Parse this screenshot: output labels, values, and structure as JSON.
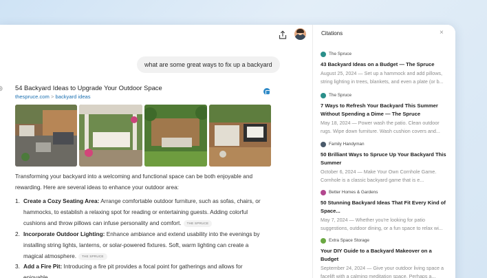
{
  "user_query": "what are some great ways to fix up a backyard",
  "result": {
    "title": "54 Backyard Ideas to Upgrade Your Outdoor Space",
    "url_domain": "thespruce.com",
    "url_separator": ">",
    "url_path": "backyard ideas"
  },
  "answer": {
    "intro": "Transforming your backyard into a welcoming and functional space can be both enjoyable and rewarding. Here are several ideas to enhance your outdoor area:",
    "items": [
      {
        "num": "1.",
        "heading": "Create a Cozy Seating Area:",
        "text": " Arrange comfortable outdoor furniture, such as sofas, chairs, or hammocks, to establish a relaxing spot for reading or entertaining guests. Adding colorful cushions and throw pillows can infuse personality and comfort.",
        "tag": "THE SPRUCE"
      },
      {
        "num": "2.",
        "heading": "Incorporate Outdoor Lighting:",
        "text": " Enhance ambiance and extend usability into the evenings by installing string lights, lanterns, or solar-powered fixtures. Soft, warm lighting can create a magical atmosphere.",
        "tag": "THE SPRUCE"
      },
      {
        "num": "3.",
        "heading": "Add a Fire Pit:",
        "text": " Introducing a fire pit provides a focal point for gatherings and allows for enjoyable",
        "tag": ""
      }
    ]
  },
  "citations": {
    "header": "Citations",
    "close_glyph": "×",
    "items": [
      {
        "source": "The Spruce",
        "color": "#2a8f8a",
        "title": "43 Backyard Ideas on a Budget — The Spruce",
        "snippet": "August 25, 2024 — Set up a hammock and add pillows, string lighting in trees, blankets, and even a plate (or b..."
      },
      {
        "source": "The Spruce",
        "color": "#2a8f8a",
        "title": "7 Ways to Refresh Your Backyard This Summer Without Spending a Dime — The Spruce",
        "snippet": "May 18, 2024 — Power wash the patio. Clean outdoor rugs. Wipe down furniture. Wash cushion covers and..."
      },
      {
        "source": "Family Handyman",
        "color": "#4a5a6b",
        "title": "50 Brilliant Ways to Spruce Up Your Backyard This Summer",
        "snippet": "October 6, 2024 — Make Your Own Cornhole Game. Cornhole is a classic backyard game that is e..."
      },
      {
        "source": "Better Homes & Gardens",
        "color": "#b2478e",
        "title": "50 Stunning Backyard Ideas That Fit Every Kind of Space...",
        "snippet": "May 7, 2024 — Whether you're looking for patio suggestions, outdoor dining, or a fun space to relax wi..."
      },
      {
        "source": "Extra Space Storage",
        "color": "#6aa842",
        "title": "Your DIY Guide to a Backyard Makeover on a Budget",
        "snippet": "September 24, 2024 — Give your outdoor living space a facelift with a calming meditation space. Perhaps a..."
      }
    ]
  },
  "icons": {
    "share": "share-icon",
    "avatar": "user-avatar",
    "citation": "citation-icon"
  }
}
